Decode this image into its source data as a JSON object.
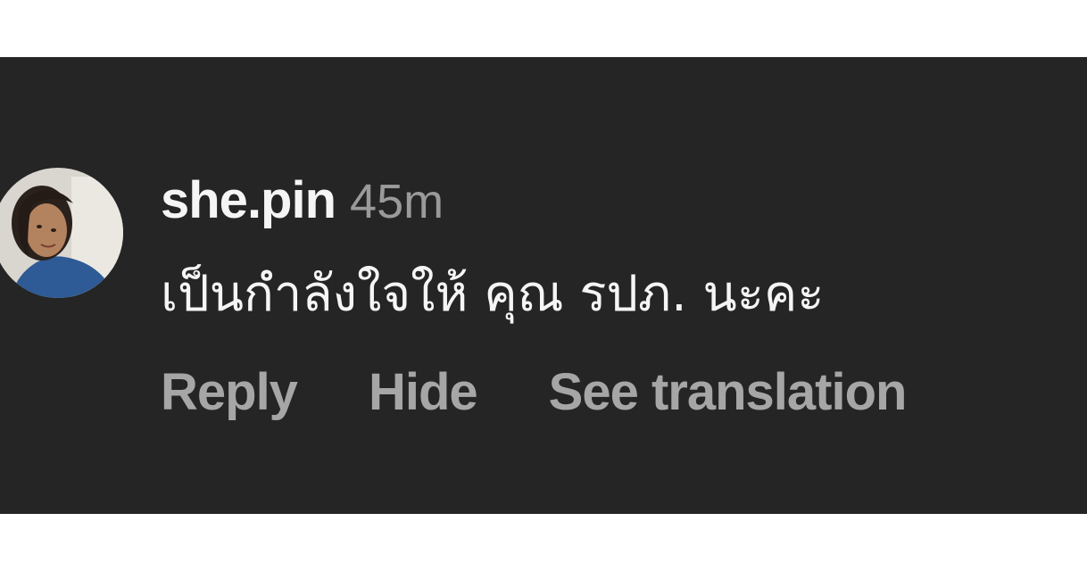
{
  "comment": {
    "username": "she.pin",
    "timestamp": "45m",
    "text": "เป็นกำลังใจให้ คุณ รปภ. นะคะ"
  },
  "actions": {
    "reply": "Reply",
    "hide": "Hide",
    "see_translation": "See translation"
  },
  "colors": {
    "panel_background": "#252525",
    "page_background": "#ffffff",
    "username": "#f5f5f5",
    "meta": "#9a9a9a",
    "action": "#a6a6a6"
  }
}
